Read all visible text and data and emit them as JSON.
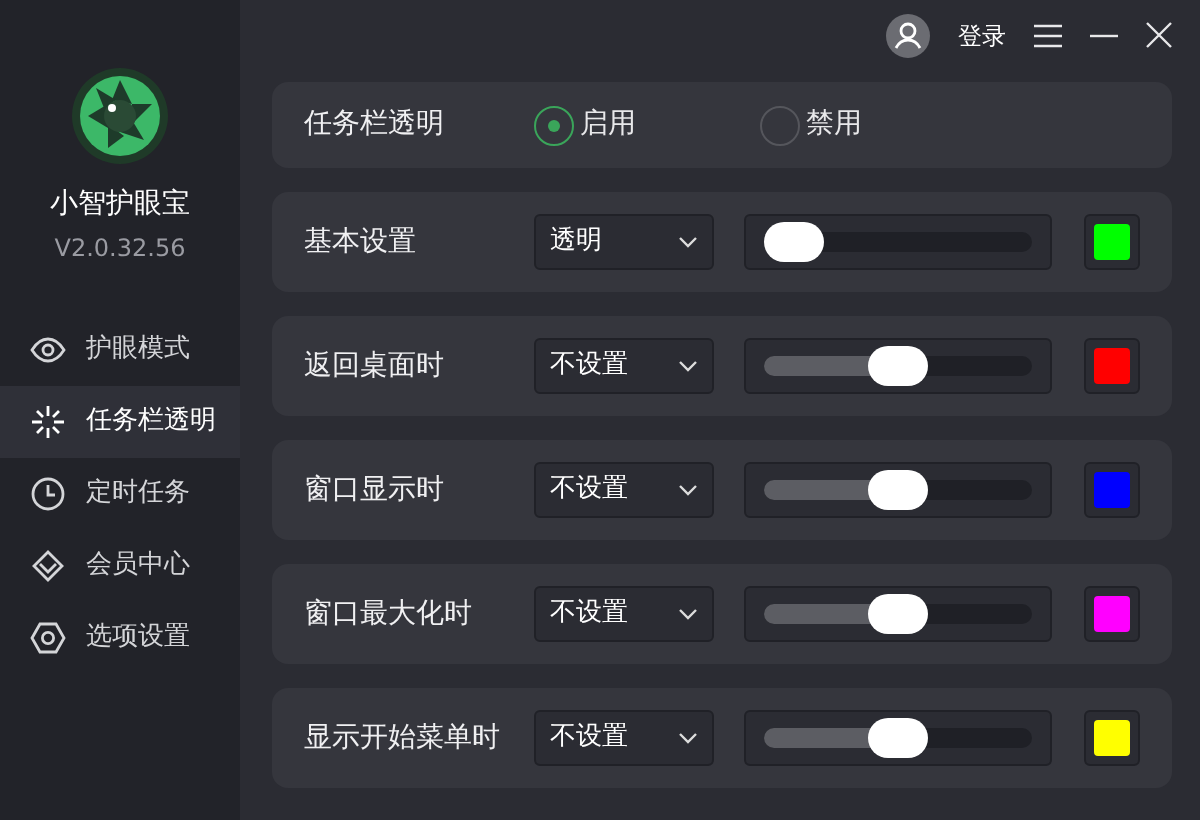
{
  "app": {
    "name": "小智护眼宝",
    "version": "V2.0.32.56"
  },
  "sidebar": {
    "items": [
      {
        "label": "护眼模式",
        "selected": false
      },
      {
        "label": "任务栏透明",
        "selected": true
      },
      {
        "label": "定时任务",
        "selected": false
      },
      {
        "label": "会员中心",
        "selected": false
      },
      {
        "label": "选项设置",
        "selected": false
      }
    ]
  },
  "header": {
    "login": "登录"
  },
  "taskbar_transparency": {
    "label": "任务栏透明",
    "options": [
      {
        "label": "启用",
        "selected": true
      },
      {
        "label": "禁用",
        "selected": false
      }
    ]
  },
  "settings": [
    {
      "label": "基本设置",
      "dropdown": "透明",
      "level": 0,
      "color": "#00ff00"
    },
    {
      "label": "返回桌面时",
      "dropdown": "不设置",
      "level": 0.5,
      "color": "#ff0000"
    },
    {
      "label": "窗口显示时",
      "dropdown": "不设置",
      "level": 0.5,
      "color": "#0000ff"
    },
    {
      "label": "窗口最大化时",
      "dropdown": "不设置",
      "level": 0.5,
      "color": "#ff00ff"
    },
    {
      "label": "显示开始菜单时",
      "dropdown": "不设置",
      "level": 0.5,
      "color": "#ffff00"
    }
  ]
}
